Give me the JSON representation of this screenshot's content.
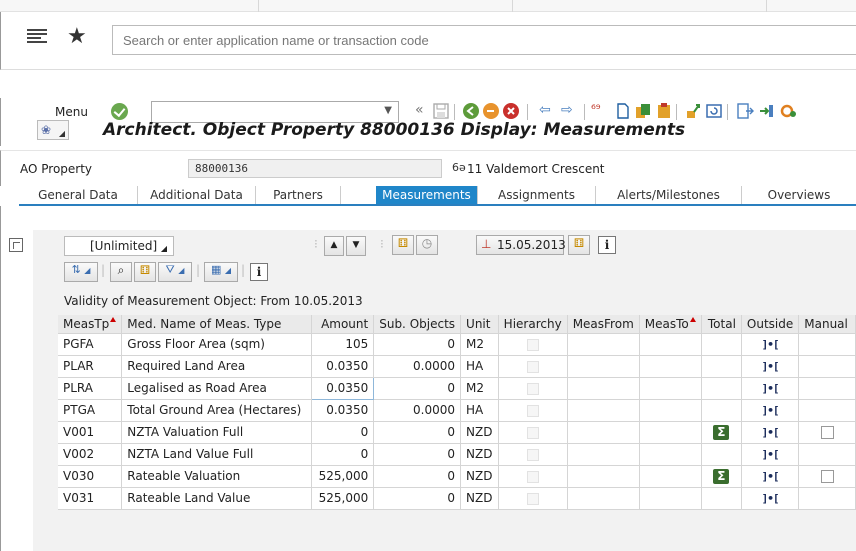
{
  "search": {
    "placeholder": "Search or enter application name or transaction code"
  },
  "toolbar": {
    "menu_label": "Menu"
  },
  "title": {
    "text": "Architect. Object Property 88000136 Display: Measurements"
  },
  "header_fields": {
    "ao_label": "AO Property",
    "ao_value": "88000136",
    "ao_description": "11 Valdemort Crescent"
  },
  "tabs": [
    {
      "label": "General Data"
    },
    {
      "label": "Additional Data"
    },
    {
      "label": "Partners"
    },
    {
      "label": "Measurements",
      "active": true
    },
    {
      "label": "Assignments"
    },
    {
      "label": "Alerts/Milestones"
    },
    {
      "label": "Overviews"
    }
  ],
  "measurements": {
    "period_selector": "[Unlimited]",
    "date": "15.05.2013",
    "validity": "Validity of Measurement Object: From 10.05.2013",
    "columns": [
      "MeasTp",
      "Med. Name of Meas. Type",
      "Amount",
      "Sub. Objects",
      "Unit",
      "Hierarchy",
      "MeasFrom",
      "MeasTo",
      "Total",
      "Outside",
      "Manual"
    ],
    "rows": [
      {
        "type": "PGFA",
        "name": "Gross Floor Area (sqm)",
        "amount": "105",
        "sub": "0",
        "unit": "M2",
        "total": "",
        "manual": false
      },
      {
        "type": "PLAR",
        "name": "Required Land Area",
        "amount": "0.0350",
        "sub": "0.0000",
        "unit": "HA",
        "total": "",
        "manual": false
      },
      {
        "type": "PLRA",
        "name": "Legalised as Road Area",
        "amount": "0.0350",
        "sub": "0",
        "unit": "M2",
        "total": "",
        "manual": false
      },
      {
        "type": "PTGA",
        "name": "Total Ground Area (Hectares)",
        "amount": "0.0350",
        "sub": "0.0000",
        "unit": "HA",
        "total": "",
        "manual": false
      },
      {
        "type": "V001",
        "name": "NZTA Valuation Full",
        "amount": "0",
        "sub": "0",
        "unit": "NZD",
        "total": "sigma",
        "manual": true
      },
      {
        "type": "V002",
        "name": "NZTA Land Value Full",
        "amount": "0",
        "sub": "0",
        "unit": "NZD",
        "total": "",
        "manual": false
      },
      {
        "type": "V030",
        "name": "Rateable Valuation",
        "amount": "525,000",
        "sub": "0",
        "unit": "NZD",
        "total": "sigma",
        "manual": true
      },
      {
        "type": "V031",
        "name": "Rateable Land Value",
        "amount": "525,000",
        "sub": "0",
        "unit": "NZD",
        "total": "",
        "manual": false
      }
    ]
  },
  "colors": {
    "accent": "#1f86c9",
    "sigma_bg": "#3a6d2e",
    "ok_green": "#6aa84f"
  },
  "icons": {
    "menu": "hamburger-icon",
    "favorite": "star-icon",
    "confirm": "check-circle-icon",
    "outside": "bracket-measure-icon",
    "total": "sigma-icon"
  }
}
